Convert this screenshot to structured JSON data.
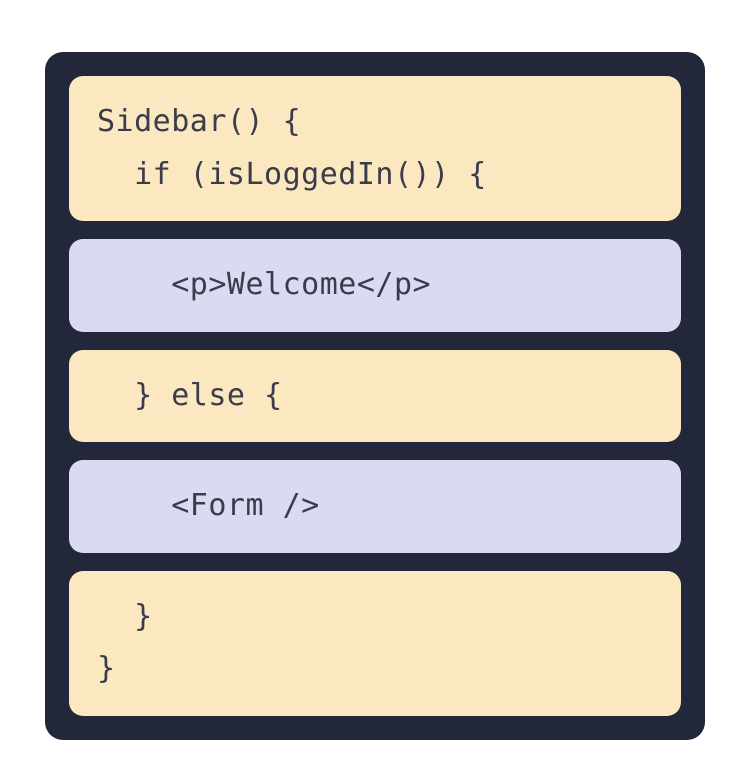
{
  "blocks": {
    "block1_line1": "Sidebar() {",
    "block1_line2": "  if (isLoggedIn()) {",
    "block2_line1": "    <p>Welcome</p>",
    "block3_line1": "  } else {",
    "block4_line1": "    <Form />",
    "block5_line1": "  }",
    "block5_line2": "}"
  },
  "colors": {
    "container_bg": "#22283a",
    "yellow_bg": "#fce8c0",
    "purple_bg": "#dadbf2",
    "text": "#3a3c4a"
  }
}
